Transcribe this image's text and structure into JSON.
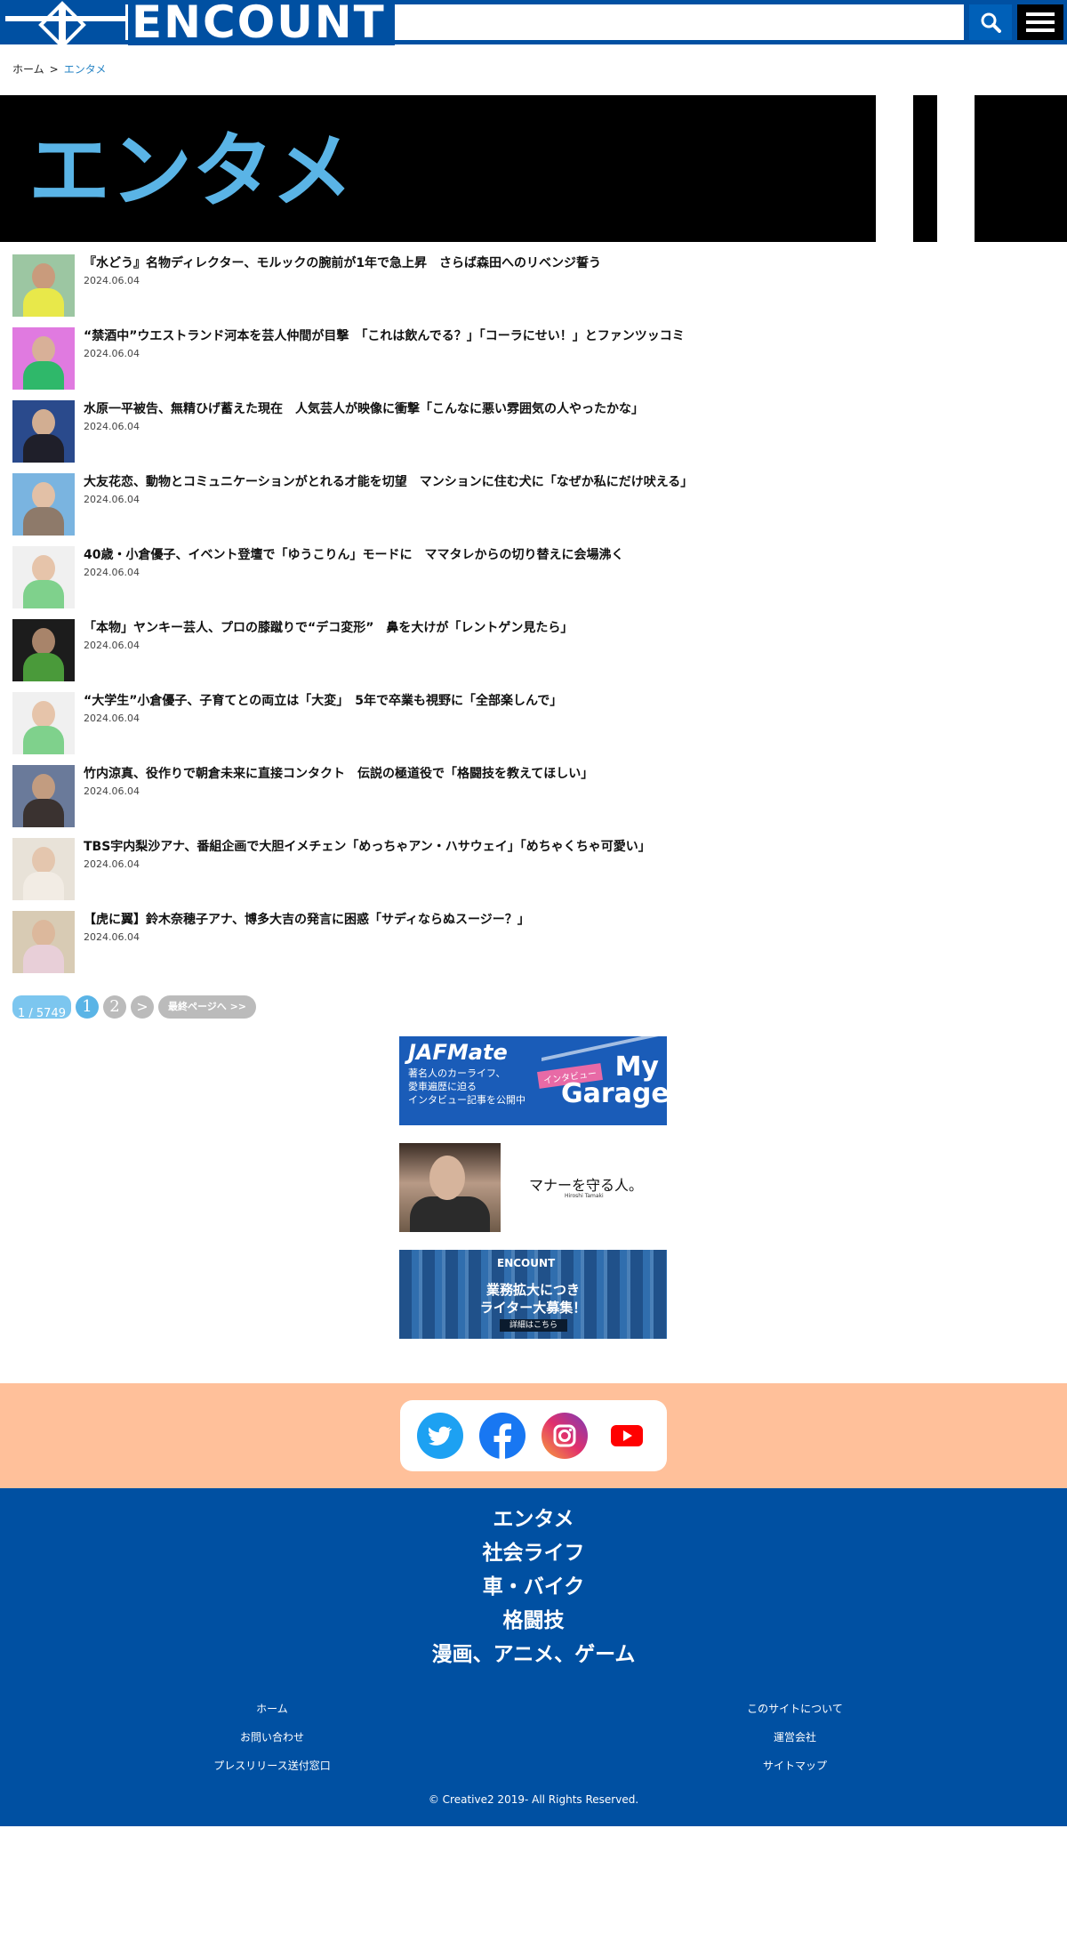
{
  "header": {
    "logo_text": "ENCOUNT",
    "search_icon": "search-icon",
    "menu_icon": "hamburger-menu-icon"
  },
  "breadcrumb": {
    "home": "ホーム",
    "separator": ">",
    "current": "エンタメ"
  },
  "banner": {
    "title": "エンタメ"
  },
  "articles": [
    {
      "title": "『水どう』名物ディレクター、モルックの腕前が1年で急上昇　さらば森田へのリベンジ誓う",
      "date": "2024.06.04"
    },
    {
      "title": "“禁酒中”ウエストランド河本を芸人仲間が目撃　「これは飲んでる？」「コーラにせい！」とファンツッコミ",
      "date": "2024.06.04"
    },
    {
      "title": "水原一平被告、無精ひげ蓄えた現在　人気芸人が映像に衝撃「こんなに悪い雰囲気の人やったかな」",
      "date": "2024.06.04"
    },
    {
      "title": "大友花恋、動物とコミュニケーションがとれる才能を切望　マンションに住む犬に「なぜか私にだけ吠える」",
      "date": "2024.06.04"
    },
    {
      "title": "40歳・小倉優子、イベント登壇で「ゆうこりん」モードに　ママタレからの切り替えに会場沸く",
      "date": "2024.06.04"
    },
    {
      "title": "「本物」ヤンキー芸人、プロの膝蹴りで“デコ変形”　鼻を大けが「レントゲン見たら」",
      "date": "2024.06.04"
    },
    {
      "title": "“大学生”小倉優子、子育てとの両立は「大変」　5年で卒業も視野に「全部楽しんで」",
      "date": "2024.06.04"
    },
    {
      "title": "竹内涼真、役作りで朝倉未来に直接コンタクト　伝説の極道役で「格闘技を教えてほしい」",
      "date": "2024.06.04"
    },
    {
      "title": "TBS宇内梨沙アナ、番組企画で大胆イメチェン「めっちゃアン・ハサウェイ」「めちゃくちゃ可愛い」",
      "date": "2024.06.04"
    },
    {
      "title": "【虎に翼】鈴木奈穂子アナ、博多大吉の発言に困惑「サディならぬスージー？」",
      "date": "2024.06.04"
    }
  ],
  "pagination": {
    "count": "1 / 5749",
    "page1": "1",
    "page2": "2",
    "next": ">",
    "last": "最終ページへ >>"
  },
  "ads": {
    "jaf": {
      "brand": "JAFMate",
      "text_line1": "著名人のカーライフ、",
      "text_line2": "愛車遍歴に迫る",
      "text_line3": "インタビュー記事を公開中",
      "tag": "インタビュー",
      "garage_line1": "My",
      "garage_line2": "Garage"
    },
    "manner": {
      "headline": "マナーを守る人。",
      "sub": "Hiroshi Tamaki"
    },
    "recruit": {
      "logo": "ENCOUNT",
      "line1": "業務拡大につき",
      "line2": "ライター大募集！",
      "button": "詳細はこちら"
    }
  },
  "social": [
    "twitter-icon",
    "facebook-icon",
    "instagram-icon",
    "youtube-icon"
  ],
  "footer": {
    "categories": [
      "エンタメ",
      "社会ライフ",
      "車・バイク",
      "格闘技",
      "漫画、アニメ、ゲーム"
    ],
    "links_left": [
      "ホーム",
      "お問い合わせ",
      "プレスリリース送付窓口"
    ],
    "links_right": [
      "このサイトについて",
      "運営会社",
      "サイトマップ"
    ],
    "copyright": "© Creative2 2019- All Rights Reserved."
  },
  "colors": {
    "brand_blue": "#0050a2",
    "accent_light_blue": "#5ab4e6",
    "social_band": "#ffc09a"
  }
}
